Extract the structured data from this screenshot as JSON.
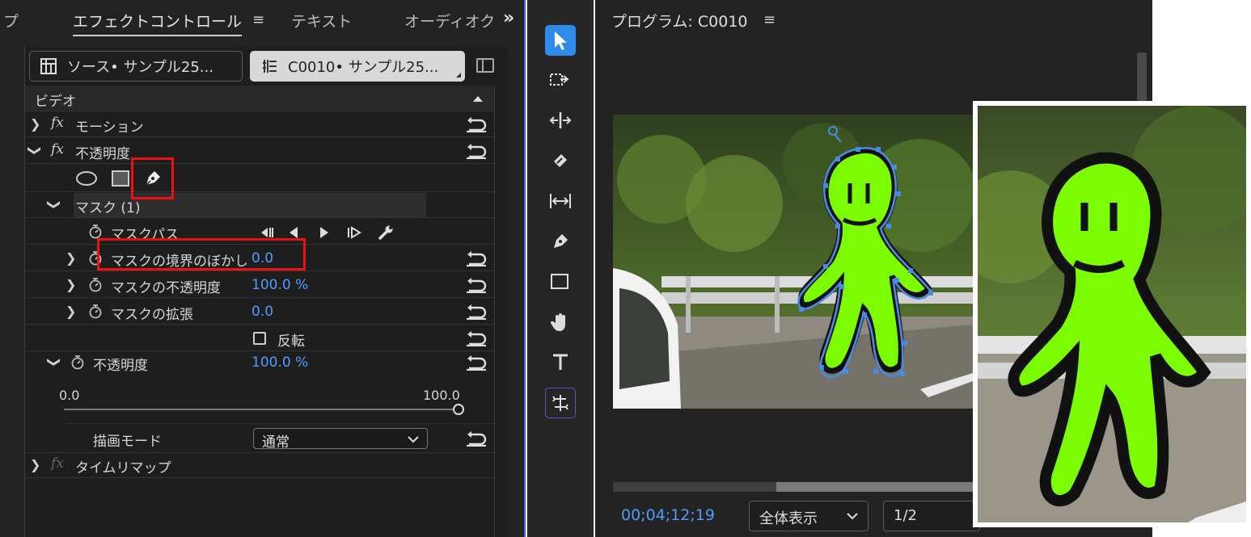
{
  "left_panel": {
    "tabs": {
      "prev_tab": "プ",
      "effect_controls": "エフェクトコントロール",
      "text": "テキスト",
      "audio": "オーディオク"
    },
    "source_label": "ソース• サンプル25...",
    "clip_label": "C0010• サンプル25...",
    "section_video": "ビデオ",
    "effects": {
      "motion": "モーション",
      "opacity": "不透明度",
      "mask": "マスク (1)",
      "mask_path": "マスクパス",
      "mask_feather": "マスクの境界のぼかし",
      "mask_feather_value": "0.0",
      "mask_opacity": "マスクの不透明度",
      "mask_opacity_value": "100.0 %",
      "mask_expansion": "マスクの拡張",
      "mask_expansion_value": "0.0",
      "invert": "反転",
      "opacity_prop": "不透明度",
      "opacity_value": "100.0 %",
      "slider_min": "0.0",
      "slider_max": "100.0",
      "slider_level": 1.0,
      "blend_mode_label": "描画モード",
      "blend_mode_value": "通常",
      "time_remap": "タイムリマップ"
    }
  },
  "program_panel": {
    "title": "プログラム: C0010",
    "timecode": "00;04;12;19",
    "zoom": "全体表示",
    "resolution": "1/2",
    "playhead_fraction": 0.45
  },
  "colors": {
    "accent_blue": "#2d8ceb",
    "value_blue": "#4d9dff",
    "highlight_red": "#ee1111",
    "character_green": "#7cfc00"
  }
}
